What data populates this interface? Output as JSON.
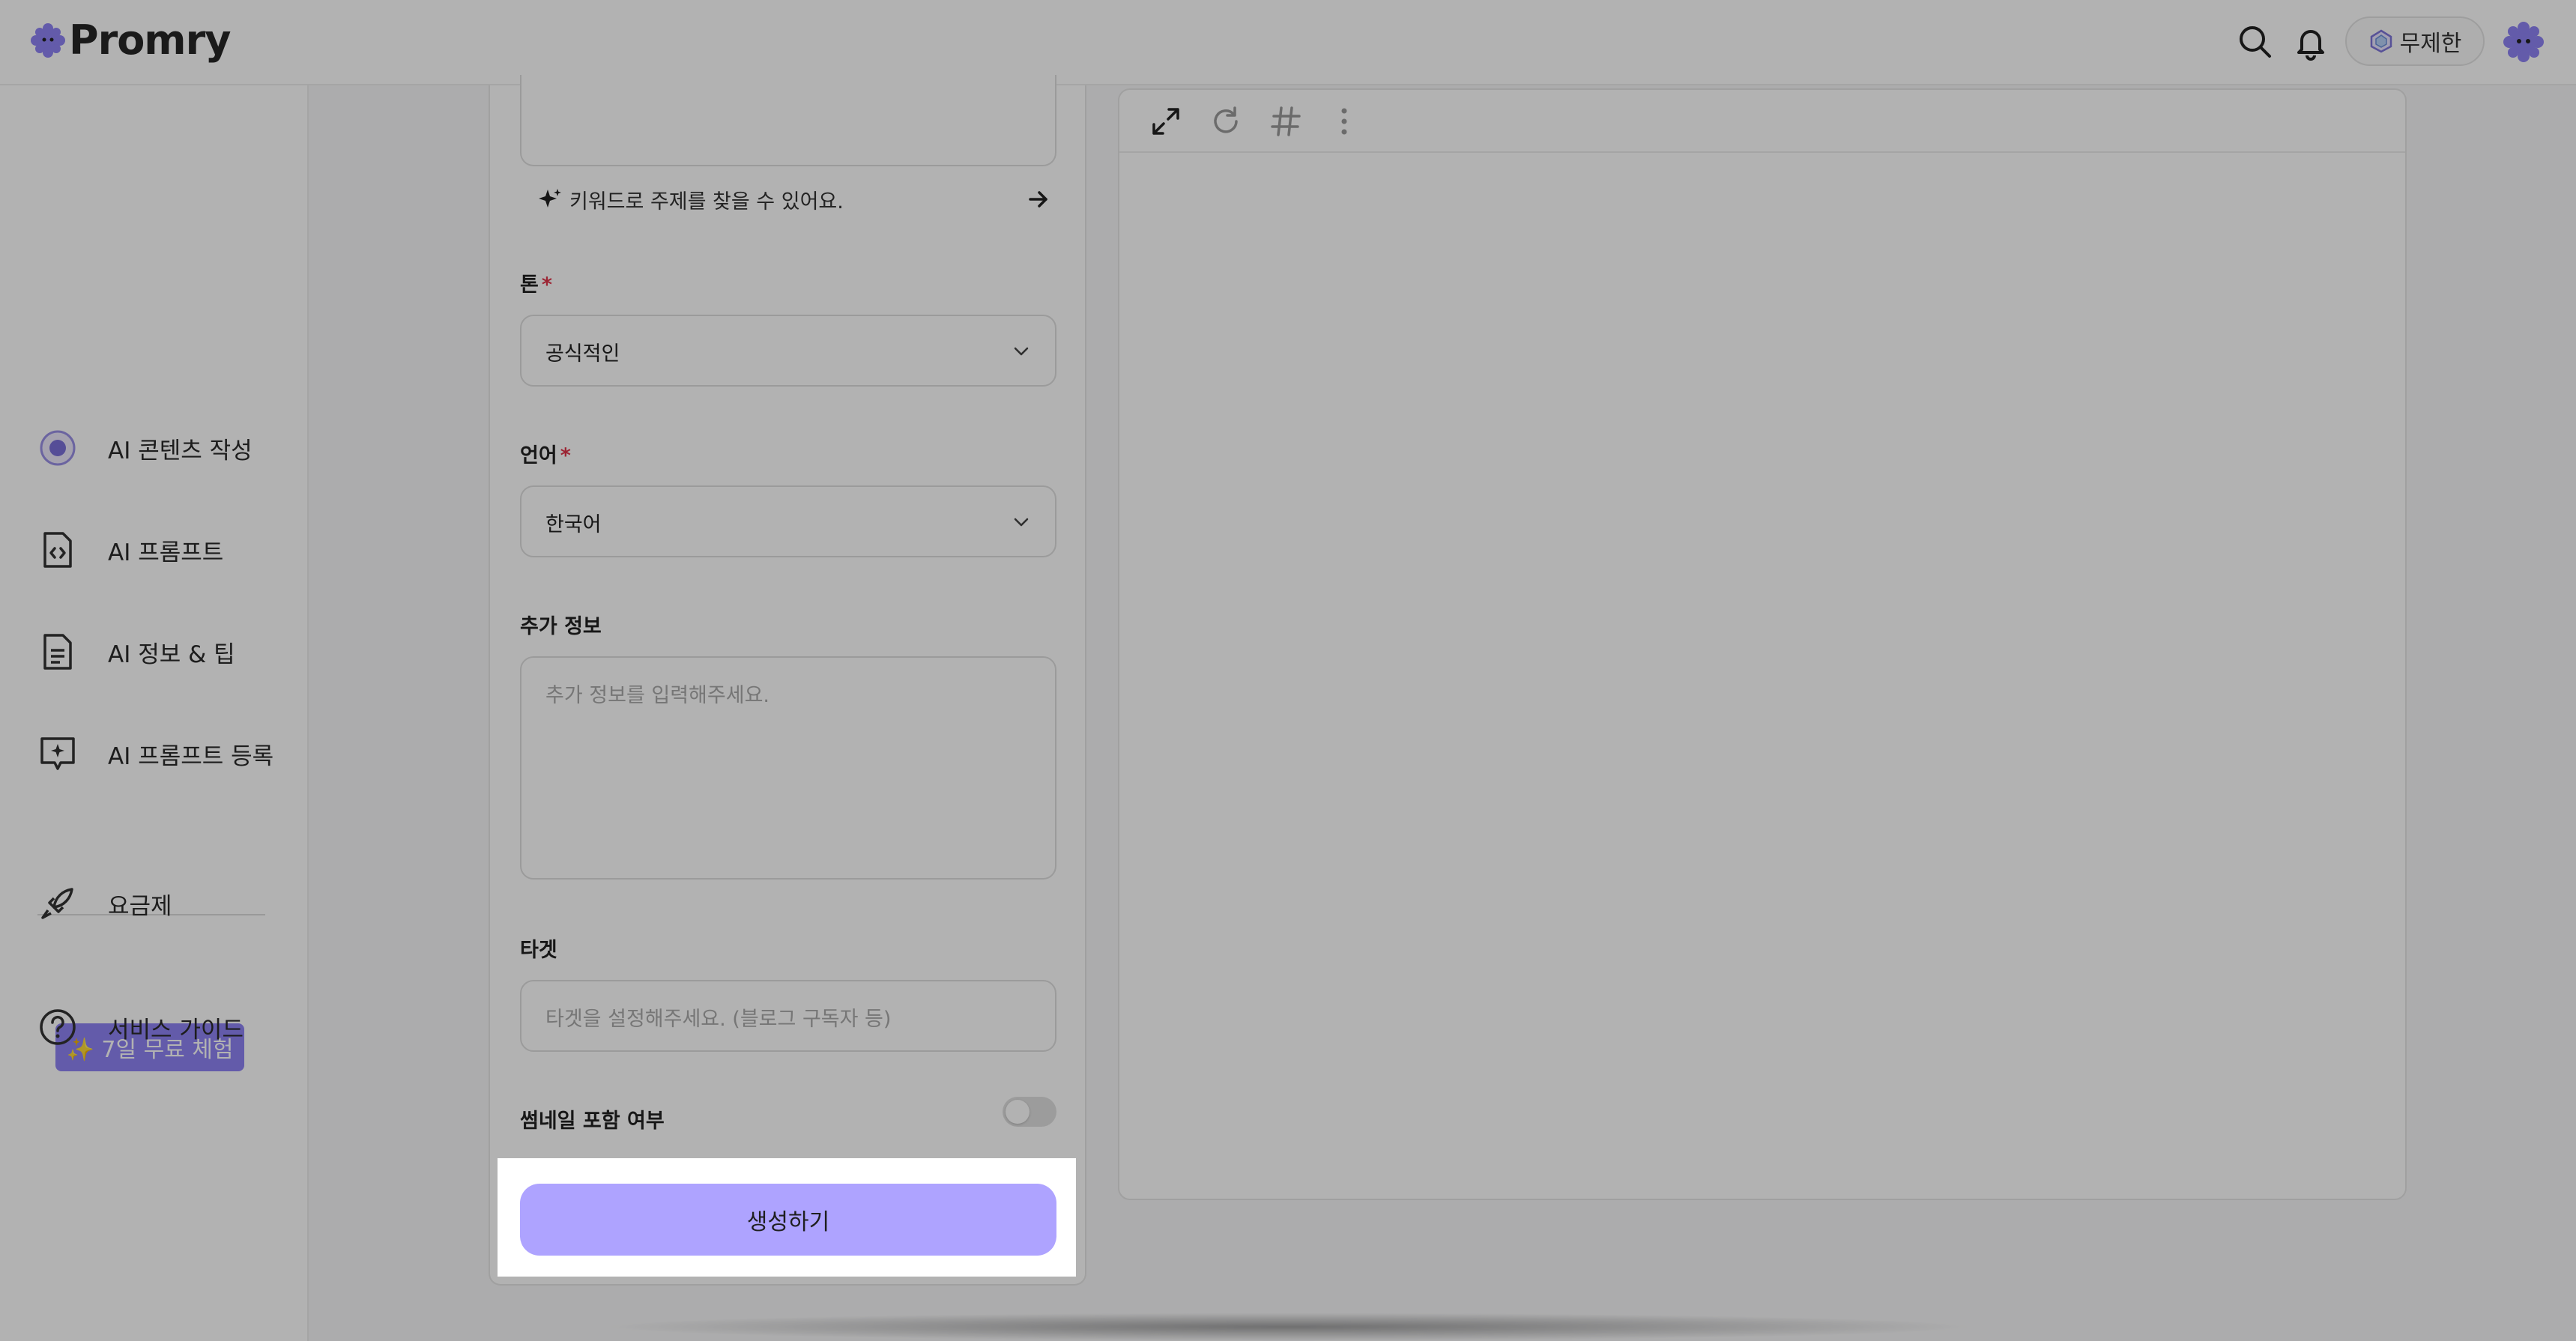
{
  "brand": {
    "name": "Promry"
  },
  "header": {
    "plan_label": "무제한"
  },
  "sidebar": {
    "items": [
      {
        "label": "AI 콘텐츠 작성",
        "icon": "ai-content-icon"
      },
      {
        "label": "AI 프롬프트",
        "icon": "code-file-icon"
      },
      {
        "label": "AI 정보 & 팁",
        "icon": "document-icon"
      },
      {
        "label": "AI 프롬프트 등록",
        "icon": "sparkle-chat-icon"
      },
      {
        "label": "요금제",
        "icon": "rocket-icon"
      },
      {
        "label": "서비스 가이드",
        "icon": "help-icon"
      }
    ],
    "trial_badge": "✨ 7일 무료 체험"
  },
  "form": {
    "keyword_hint": "키워드로 주제를 찾을 수 있어요.",
    "tone": {
      "label": "톤",
      "required_mark": "*",
      "value": "공식적인"
    },
    "language": {
      "label": "언어",
      "required_mark": "*",
      "value": "한국어"
    },
    "extra_info": {
      "label": "추가 정보",
      "placeholder": "추가 정보를 입력해주세요."
    },
    "target": {
      "label": "타겟",
      "placeholder": "타겟을 설정해주세요. (블로그 구독자 등)"
    },
    "thumbnail": {
      "label": "썸네일 포함 여부",
      "enabled": false
    },
    "generate_label": "생성하기"
  },
  "colors": {
    "accent": "#aea3ff",
    "brand": "#8e83f4",
    "required": "#e0344a"
  }
}
